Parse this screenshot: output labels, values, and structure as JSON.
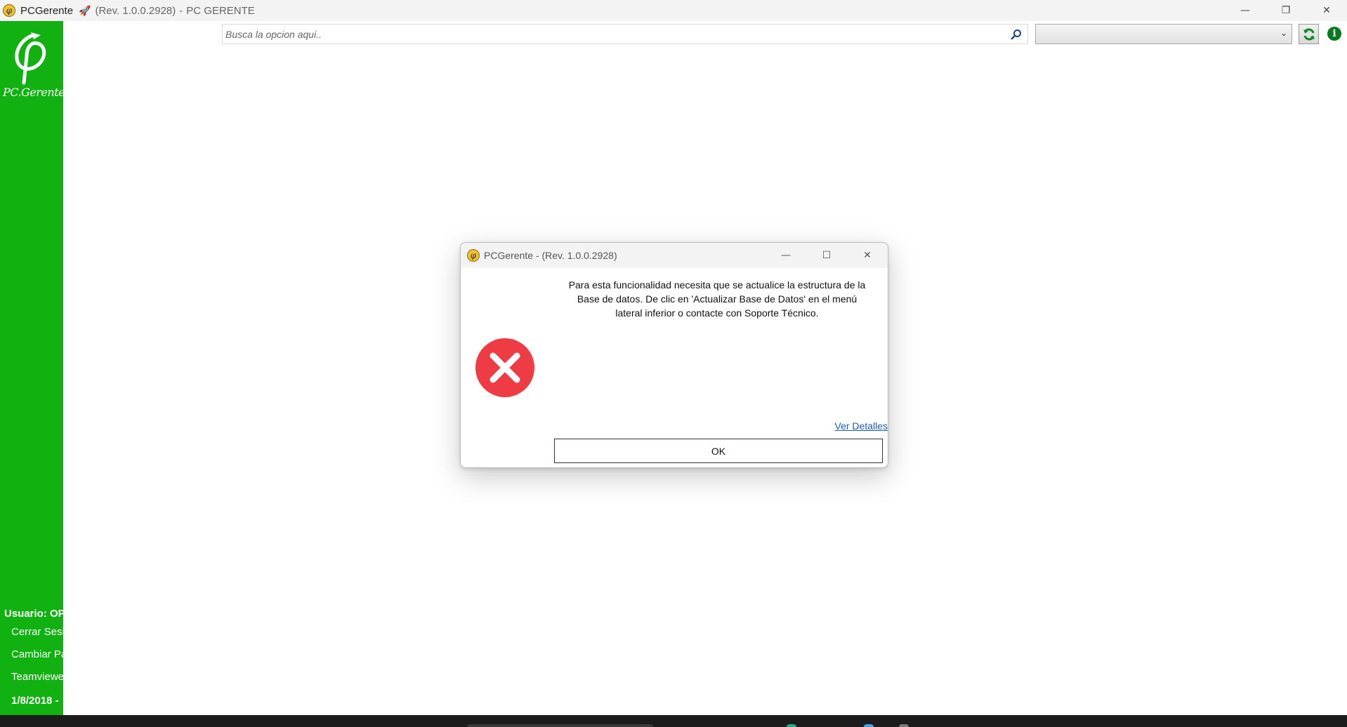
{
  "window": {
    "app_name": "PCGerente",
    "revision": "(Rev. 1.0.0.2928)",
    "separator": "-",
    "subtitle": "PC GERENTE",
    "controls": {
      "minimize": "—",
      "restore": "❐",
      "close": "✕"
    }
  },
  "sidebar": {
    "logo_text": "PC.Gerente",
    "user_label": "Usuario: OP",
    "links": [
      {
        "label": "Cerrar Sesi"
      },
      {
        "label": "Cambiar Pa"
      },
      {
        "label": "Teamviewer"
      }
    ],
    "date": "1/8/2018 -"
  },
  "toolbar": {
    "search_placeholder": "Busca la opcion aqui..",
    "search_value": "",
    "combo_value": ""
  },
  "dialog": {
    "title": "PCGerente - (Rev. 1.0.0.2928)",
    "message_lines": [
      "Para esta funcionalidad necesita que se actualice la estructura de la",
      "Base de datos. De clic en 'Actualizar Base de Datos' en el menú",
      "lateral inferior o contacte con Soporte Técnico."
    ],
    "details_link": "Ver Detalles",
    "ok_label": "OK"
  },
  "colors": {
    "sidebar_green": "#12b112",
    "error_red": "#ee3b44",
    "link_blue": "#1a5fb4",
    "info_green": "#0a7a20"
  },
  "icons": {
    "app": "pcgerente-logo-icon",
    "search": "search-icon",
    "refresh": "refresh-icon",
    "info": "info-icon",
    "error": "error-icon"
  }
}
